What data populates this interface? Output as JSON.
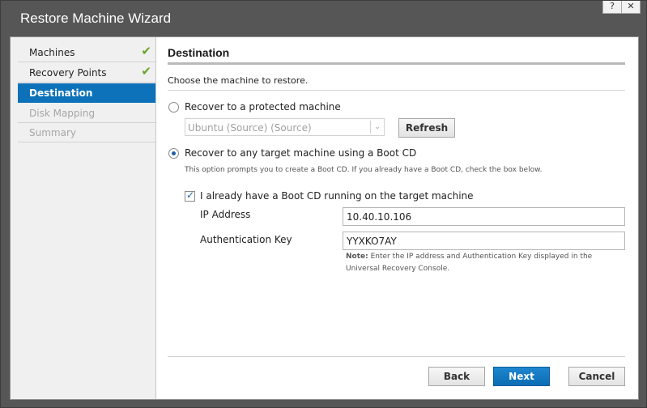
{
  "window": {
    "title": "Restore Machine Wizard",
    "help_label": "?",
    "close_label": "✕"
  },
  "sidebar": {
    "items": [
      {
        "label": "Machines",
        "state": "completed",
        "check": "✔"
      },
      {
        "label": "Recovery Points",
        "state": "completed",
        "check": "✔"
      },
      {
        "label": "Destination",
        "state": "active",
        "check": ""
      },
      {
        "label": "Disk Mapping",
        "state": "disabled",
        "check": ""
      },
      {
        "label": "Summary",
        "state": "disabled",
        "check": ""
      }
    ]
  },
  "main": {
    "heading": "Destination",
    "subtitle": "Choose the machine to restore.",
    "option_protected": {
      "label": "Recover to a protected machine",
      "selected": false,
      "select_value": "Ubuntu (Source) (Source)",
      "select_arrow": "⌄",
      "refresh_label": "Refresh"
    },
    "option_bootcd": {
      "label": "Recover to any target machine using a Boot CD",
      "selected": true,
      "description": "This option prompts you to create a Boot CD. If you already have a Boot CD, check the box below.",
      "checkbox_label": "I already have a Boot CD running on the target machine",
      "checkbox_checked": true,
      "ip_label": "IP Address",
      "ip_value": "10.40.10.106",
      "key_label": "Authentication Key",
      "key_value": "YYXKO7AY",
      "note_bold": "Note:",
      "note_line1": " Enter the IP address and Authentication Key displayed in the",
      "note_line2": "Universal Recovery Console."
    }
  },
  "footer": {
    "back_label": "Back",
    "next_label": "Next",
    "cancel_label": "Cancel"
  },
  "colors": {
    "accent": "#0d72b9",
    "check": "#6aa42a",
    "title_bar": "#565656"
  }
}
